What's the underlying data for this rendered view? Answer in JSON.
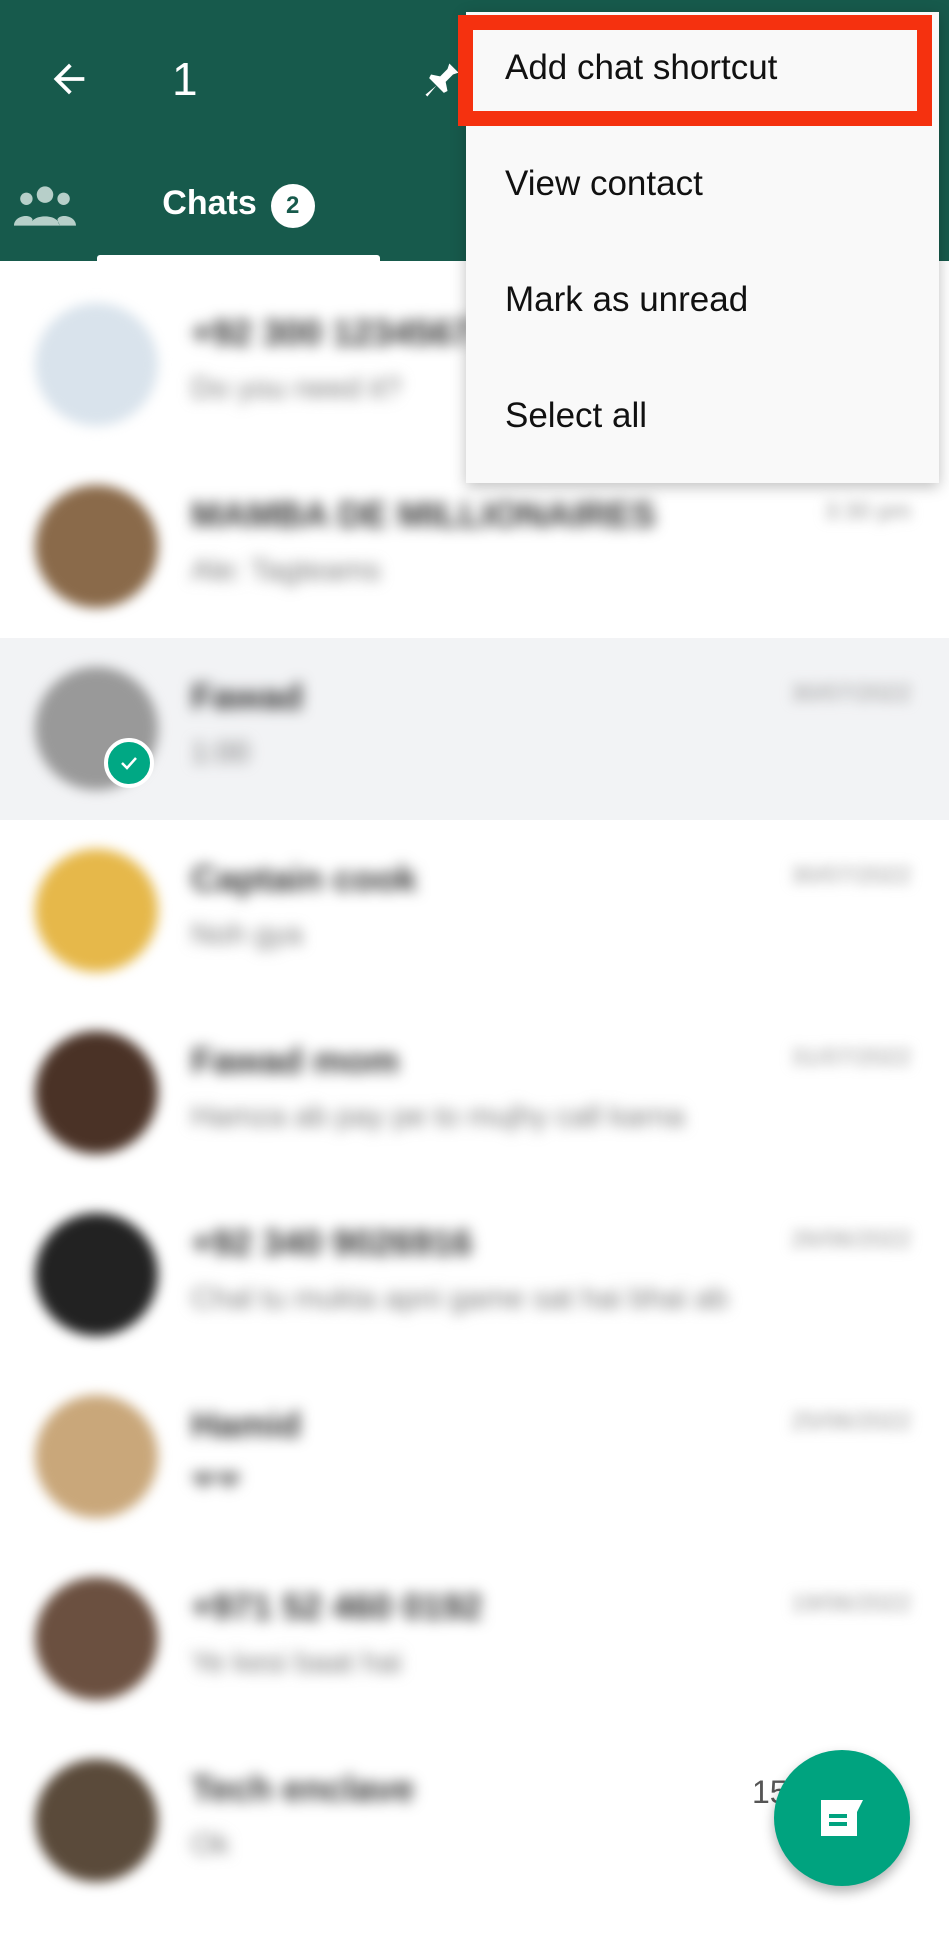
{
  "header": {
    "selected_count": "1",
    "tab_label": "Chats",
    "tab_badge": "2",
    "color": "#175a4c"
  },
  "menu": {
    "items": [
      "Add chat shortcut",
      "View contact",
      "Mark as unread",
      "Select all"
    ],
    "highlighted": "Add chat shortcut",
    "highlight_color": "#f5310f"
  },
  "chats": [
    {
      "name": "+92 300 1234567",
      "message": "Do you need it?",
      "time": "",
      "avatar": "#d9e3ec"
    },
    {
      "name": "MAMBA DE MILLIONAIRES",
      "message": "Ale: Tagteams",
      "time": "3:30 pm",
      "avatar": "#8a6a4a"
    },
    {
      "name": "Fawad",
      "message": "1:00",
      "time": "30/07/2022",
      "avatar": "#999999",
      "selected": true
    },
    {
      "name": "Captain cook",
      "message": "Noh gya",
      "time": "30/07/2022",
      "avatar": "#e6b84a"
    },
    {
      "name": "Fawad mom",
      "message": "Hamza ab pay pe to mujhy call karna",
      "time": "31/07/2022",
      "avatar": "#4a3226"
    },
    {
      "name": "+92 340 9026916",
      "message": "Chal tu mukta apni game sat hai bhai ab",
      "time": "26/06/2022",
      "avatar": "#222222"
    },
    {
      "name": "Hamid",
      "message": "❤❤",
      "time": "25/06/2022",
      "avatar": "#c9a77a"
    },
    {
      "name": "+971 52 460 0192",
      "message": "Ye kesi baat hai",
      "time": "19/06/2022",
      "avatar": "#6b5040"
    },
    {
      "name": "Tech enclave",
      "message": "Ok",
      "time": "15",
      "avatar": "#5a4a3a"
    }
  ],
  "fab": {
    "icon": "new-chat-icon",
    "color": "#00a37f"
  }
}
